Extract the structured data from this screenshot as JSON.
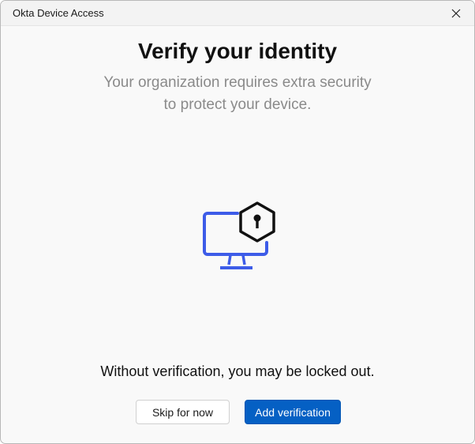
{
  "window": {
    "title": "Okta Device Access"
  },
  "main": {
    "heading": "Verify your identity",
    "subtitle_line1": "Your organization requires extra security",
    "subtitle_line2": "to protect your device.",
    "warning": "Without verification, you may be locked out."
  },
  "buttons": {
    "skip": "Skip for now",
    "add": "Add verification"
  },
  "colors": {
    "accent": "#0560c4",
    "monitor": "#3d5ce8"
  }
}
